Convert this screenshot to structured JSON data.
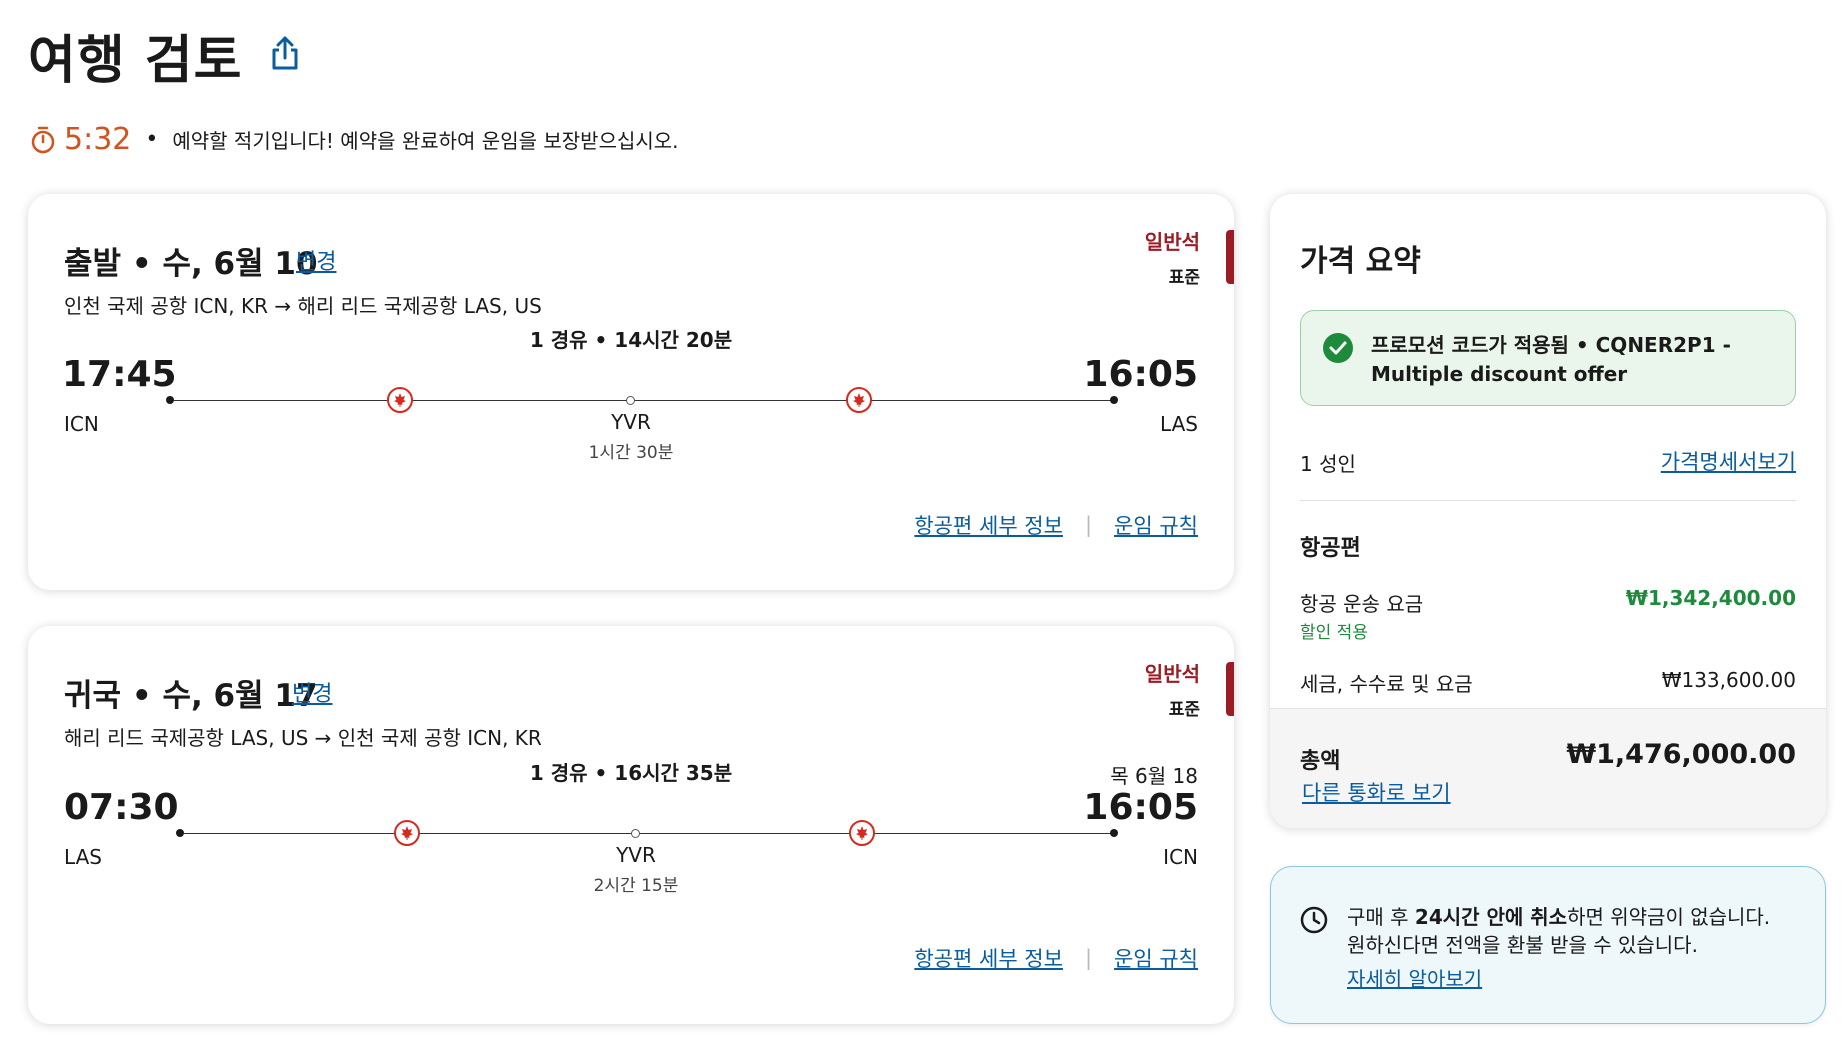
{
  "page": {
    "title": "여행 검토"
  },
  "timer": {
    "value": "5:32",
    "bullet": "•",
    "message": "예약할 적기입니다! 예약을 완료하여 운임을 보장받으십시오."
  },
  "flights": [
    {
      "title": "출발 • 수, 6월 10",
      "change_label": "변경",
      "route": "인천 국제 공항 ICN, KR → 해리 리드 국제공항 LAS, US",
      "cabin_name": "일반석",
      "cabin_type": "표준",
      "summary": "1 경유  •  14시간 20분",
      "dep_time": "17:45",
      "dep_code": "ICN",
      "arr_time": "16:05",
      "arr_code": "LAS",
      "arr_date": "",
      "stop_code": "YVR",
      "stop_duration": "1시간 30분",
      "details_link": "항공편 세부 정보",
      "separator": "|",
      "fare_rules_link": "운임 규칙"
    },
    {
      "title": "귀국 • 수, 6월 17",
      "change_label": "변경",
      "route": "해리 리드 국제공항 LAS, US → 인천 국제 공항 ICN, KR",
      "cabin_name": "일반석",
      "cabin_type": "표준",
      "summary": "1 경유  •  16시간 35분",
      "dep_time": "07:30",
      "dep_code": "LAS",
      "arr_time": "16:05",
      "arr_code": "ICN",
      "arr_date": "목 6월 18",
      "stop_code": "YVR",
      "stop_duration": "2시간 15분",
      "details_link": "항공편 세부 정보",
      "separator": "|",
      "fare_rules_link": "운임 규칙"
    }
  ],
  "price_summary": {
    "title": "가격 요약",
    "promo_line1": "프로모션 코드가 적용됨 • CQNER2P1 -",
    "promo_line2": "Multiple discount offer",
    "passengers": "1 성인",
    "breakdown_link": "가격명세서보기",
    "section_title": "항공편",
    "fare_label": "항공 운송 요금",
    "fare_value": "₩1,342,400.00",
    "discount_note": "할인 적용",
    "tax_label": "세금, 수수료 및 요금",
    "tax_value": "₩133,600.00",
    "total_label": "총액",
    "total_value": "₩1,476,000.00",
    "currency_link": "다른 통화로 보기"
  },
  "cancel_info": {
    "line1_pre": "구매 후 ",
    "line1_bold": "24시간 안에 취소",
    "line1_post": "하면 위약금이 없습니다.",
    "line2": "원하신다면 전액을 환불 받을 수 있습니다.",
    "link": "자세히 알아보기"
  },
  "colors": {
    "timer": "#d2541c",
    "cabin": "#9b1c24",
    "link": "#0a5c9e",
    "discount": "#1e8a3c",
    "airline_red": "#d52b1e"
  },
  "icons": {
    "share": "share-icon",
    "timer": "stopwatch-icon",
    "airline": "maple-leaf-icon",
    "promo": "check-circle-icon",
    "cancel": "clock-icon"
  }
}
